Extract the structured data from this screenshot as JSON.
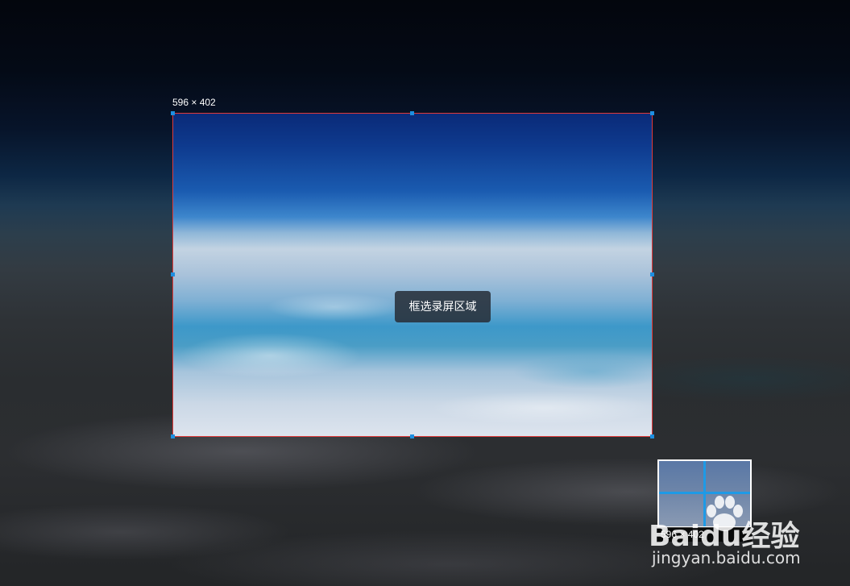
{
  "screen_capture": {
    "size_label": "596 × 402",
    "hint": "框选录屏区域",
    "magnifier": {
      "readout": "596 × 402"
    },
    "colors": {
      "selection_border": "#e03a3a",
      "handle": "#1e8fe0",
      "magnifier_crosshair": "#1e9ae6"
    }
  },
  "watermark": {
    "logo_text": "Baidu经验",
    "url": "jingyan.baidu.com",
    "icon": "paw-icon"
  }
}
